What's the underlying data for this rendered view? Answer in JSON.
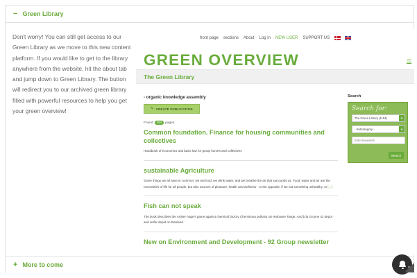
{
  "accordion": {
    "open_sign": "−",
    "open_title": "Green Library",
    "closed_sign": "+",
    "closed_title": "More to come"
  },
  "intro_text": "Don't worry! You can still get access to our Green Library as we move to this new content platform. If you would like to get to the library anywhere from the website, hit the about tab and jump down to Green Library. The button will redirect you to our archived green library filled with powerful resources to help you get your green overview!",
  "site": {
    "nav": [
      {
        "label": "front page",
        "highlight": false
      },
      {
        "label": "sections",
        "highlight": false
      },
      {
        "label": "About",
        "highlight": false
      },
      {
        "label": "Log in",
        "highlight": false
      },
      {
        "label": "NEW USER",
        "highlight": true
      },
      {
        "label": "SUPPORT US",
        "highlight": false
      }
    ],
    "brand": "GREEN OVERVIEW",
    "banner": "The Green Library",
    "section_title": "- organic knowledge assembly",
    "create_button": "CREATE PUBLICATION",
    "found_prefix": "Found",
    "found_count": "294",
    "found_suffix": "pages",
    "results": [
      {
        "title": "Common foundation. Finance for housing communities and collectives",
        "desc": "Handbook of economics and basic law for group homes and collectives"
      },
      {
        "title": "sustainable Agriculture",
        "desc": "Some things we all have in common: we eat food, we drink water, and we breathe the air that surrounds us. Food, water and air are the necessities of life for all people, but also sources of pleasure, health and wellness - or the opposite, if we eat something unhealthy, or",
        "more": "[...]"
      },
      {
        "title": "Fish can not speak",
        "desc": "The book describes the Amber Aage's game against chemical factory Cheminova pollution at Harboøre Tange. And b.la Groyne 42 depot and sulfur depot on Rønland."
      },
      {
        "title": "New on Environment and Development - 92 Group newsletter",
        "desc": ""
      }
    ],
    "search": {
      "label": "Search",
      "heading": "Search for:",
      "library_select": "The Green Library (1184)",
      "subcategory_select": "- Subcategory -",
      "keywords_placeholder": "Enter keywords",
      "button": "Search"
    }
  },
  "colors": {
    "accent": "#6aac3c",
    "search_panel": "#8dbb58",
    "button_light": "#a8d06a"
  },
  "icons": {
    "pen": "pencil-icon",
    "bell": "bell-icon",
    "menu": "hamburger-icon"
  }
}
